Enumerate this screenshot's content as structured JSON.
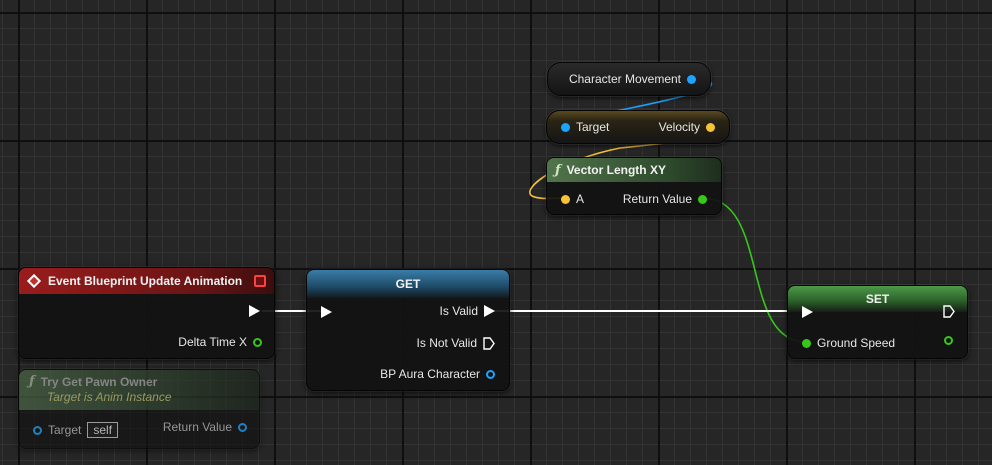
{
  "nodes": {
    "char_movement": {
      "label": "Character Movement"
    },
    "velocity_get": {
      "target_label": "Target",
      "velocity_label": "Velocity"
    },
    "vector_length": {
      "title": "Vector Length XY",
      "a_label": "A",
      "return_label": "Return Value"
    },
    "event_update": {
      "title": "Event Blueprint Update Animation",
      "delta_label": "Delta Time X"
    },
    "try_get_pawn": {
      "title": "Try Get Pawn Owner",
      "subtitle": "Target is Anim Instance",
      "target_label": "Target",
      "self_value": "self",
      "return_label": "Return Value"
    },
    "get": {
      "title": "GET",
      "is_valid": "Is Valid",
      "is_not_valid": "Is Not Valid",
      "bp_aura": "BP Aura Character"
    },
    "set": {
      "title": "SET",
      "ground_speed": "Ground Speed"
    }
  },
  "colors": {
    "object_pin": "#1aa3ff",
    "struct_pin": "#f6c236",
    "float_pin": "#35c81a",
    "exec_pin": "#ffffff",
    "event_header": "#8e1a1a",
    "function_header": "#3f5e3c",
    "get_header": "#2e6a8e",
    "set_header": "#3e8a3a"
  }
}
